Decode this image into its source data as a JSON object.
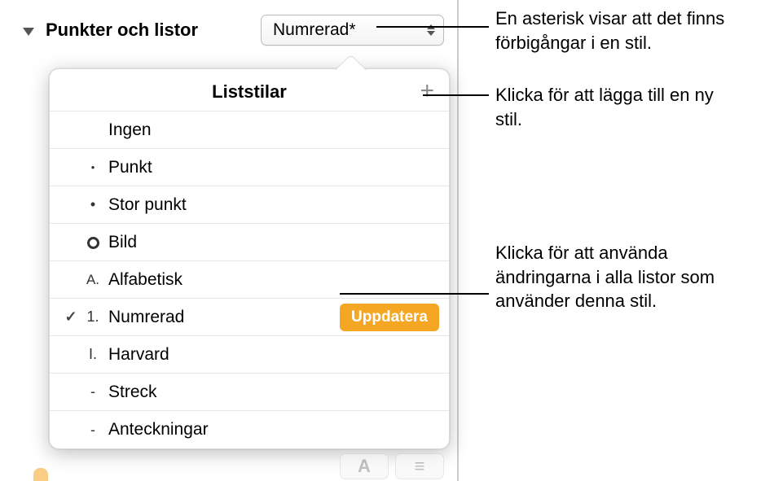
{
  "section": {
    "label": "Punkter och listor",
    "selected_style": "Numrerad*"
  },
  "popover": {
    "title": "Liststilar",
    "add_glyph": "+",
    "items": [
      {
        "bullet": "",
        "label": "Ingen",
        "selected": false,
        "showUpdate": false
      },
      {
        "bullet": "•",
        "label": "Punkt",
        "selected": false,
        "showUpdate": false
      },
      {
        "bullet": "•",
        "label": "Stor punkt",
        "selected": false,
        "showUpdate": false
      },
      {
        "bullet": "◯",
        "label": "Bild",
        "selected": false,
        "showUpdate": false
      },
      {
        "bullet": "A.",
        "label": "Alfabetisk",
        "selected": false,
        "showUpdate": false
      },
      {
        "bullet": "1.",
        "label": "Numrerad",
        "selected": true,
        "showUpdate": true
      },
      {
        "bullet": "I.",
        "label": "Harvard",
        "selected": false,
        "showUpdate": false
      },
      {
        "bullet": "-",
        "label": "Streck",
        "selected": false,
        "showUpdate": false
      },
      {
        "bullet": "-",
        "label": "Anteckningar",
        "selected": false,
        "showUpdate": false
      }
    ],
    "update_label": "Uppdatera"
  },
  "callouts": {
    "asterisk": "En asterisk visar att det finns förbigångar i en stil.",
    "add": "Klicka för att lägga till en ny stil.",
    "update": "Klicka för att använda ändringarna i alla listor som använder denna stil."
  },
  "glyphs": {
    "check": "✓",
    "format_A": "A",
    "align_icon": "≡"
  }
}
